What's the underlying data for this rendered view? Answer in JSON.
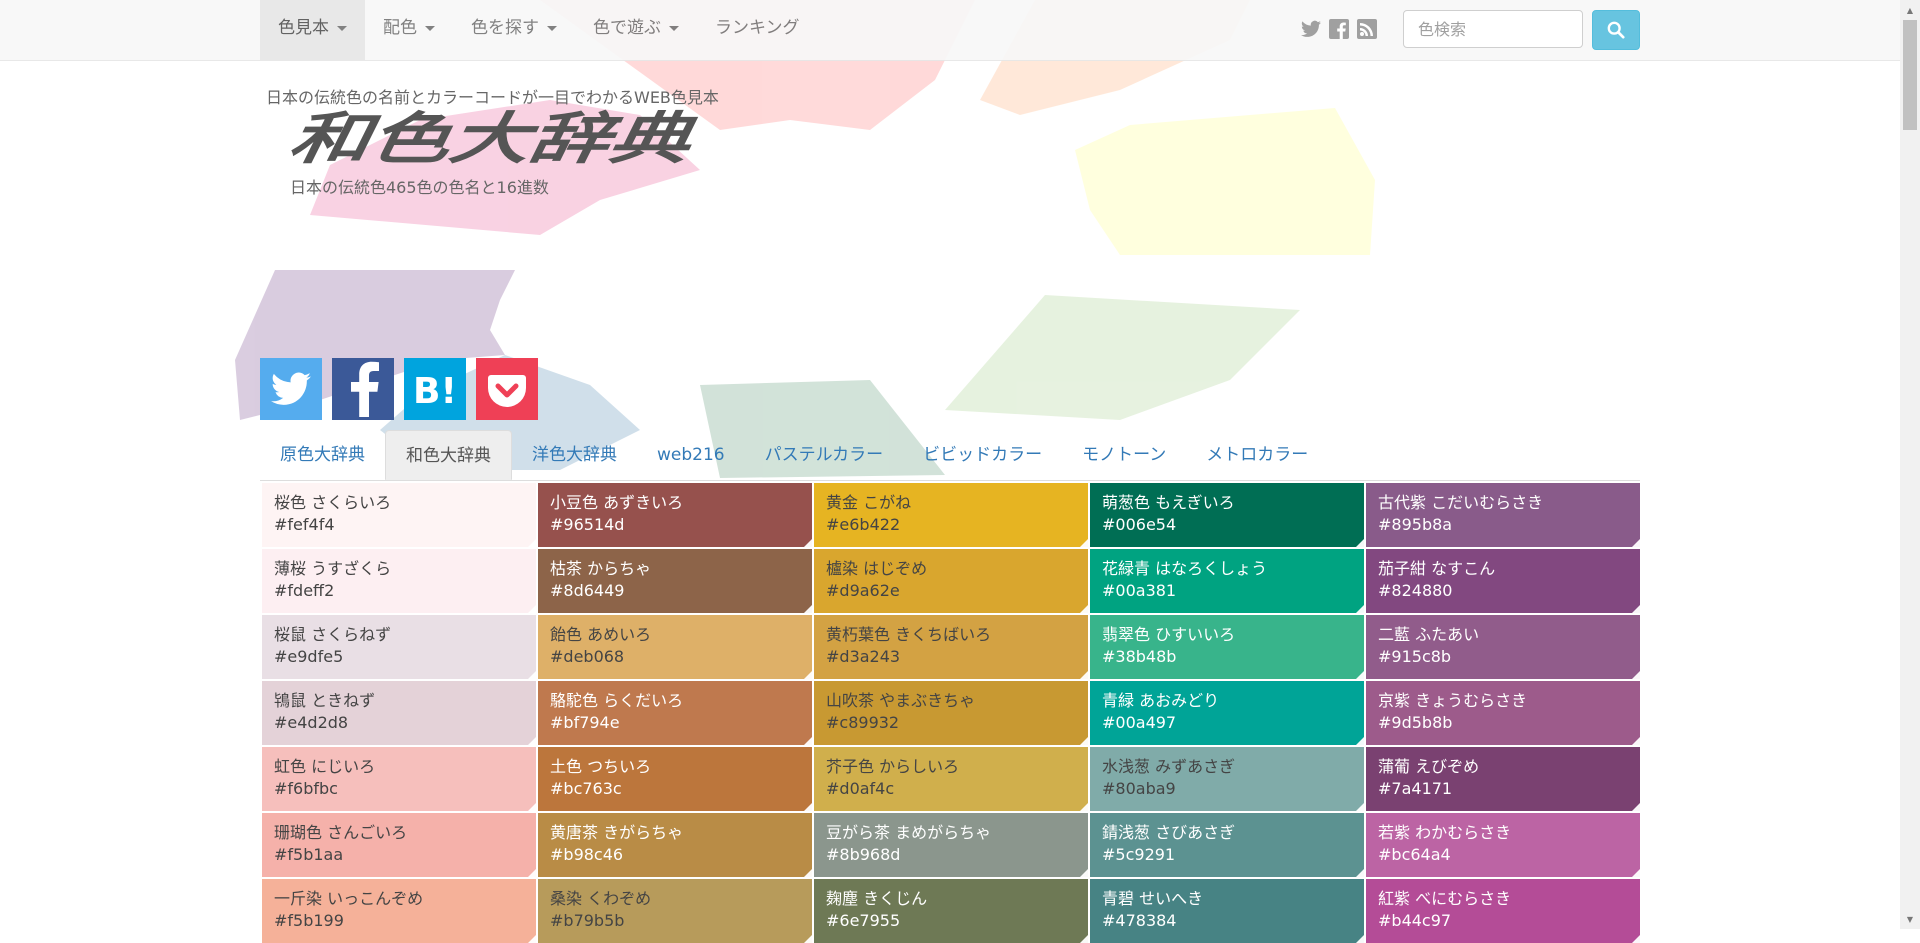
{
  "navbar": {
    "items": [
      {
        "label": "色見本",
        "dropdown": true,
        "active": true
      },
      {
        "label": "配色",
        "dropdown": true
      },
      {
        "label": "色を探す",
        "dropdown": true
      },
      {
        "label": "色で遊ぶ",
        "dropdown": true
      },
      {
        "label": "ランキング",
        "dropdown": false
      }
    ],
    "social_icons": [
      "twitter-icon",
      "facebook-icon",
      "rss-icon"
    ],
    "search": {
      "placeholder": "色検索",
      "value": ""
    }
  },
  "header": {
    "tagline": "日本の伝統色の名前とカラーコードが一目でわかるWEB色見本",
    "logo_text": "和色大辞典",
    "subtitle": "日本の伝統色465色の色名と16進数"
  },
  "share_buttons": [
    {
      "name": "twitter",
      "color": "#55acee"
    },
    {
      "name": "facebook",
      "color": "#3b5998"
    },
    {
      "name": "hatena-bookmark",
      "color": "#00a4de"
    },
    {
      "name": "pocket",
      "color": "#ef4056"
    }
  ],
  "tabs": [
    {
      "label": "原色大辞典",
      "active": false
    },
    {
      "label": "和色大辞典",
      "active": true
    },
    {
      "label": "洋色大辞典",
      "active": false
    },
    {
      "label": "web216",
      "active": false
    },
    {
      "label": "パステルカラー",
      "active": false
    },
    {
      "label": "ビビッドカラー",
      "active": false
    },
    {
      "label": "モノトーン",
      "active": false
    },
    {
      "label": "メトロカラー",
      "active": false
    }
  ],
  "colors": [
    [
      {
        "name": "桜色 さくらいろ",
        "hex": "#fef4f4"
      },
      {
        "name": "小豆色 あずきいろ",
        "hex": "#96514d"
      },
      {
        "name": "黄金 こがね",
        "hex": "#e6b422"
      },
      {
        "name": "萌葱色 もえぎいろ",
        "hex": "#006e54"
      },
      {
        "name": "古代紫 こだいむらさき",
        "hex": "#895b8a"
      }
    ],
    [
      {
        "name": "薄桜 うすざくら",
        "hex": "#fdeff2"
      },
      {
        "name": "枯茶 からちゃ",
        "hex": "#8d6449"
      },
      {
        "name": "櫨染 はじぞめ",
        "hex": "#d9a62e"
      },
      {
        "name": "花緑青 はなろくしょう",
        "hex": "#00a381"
      },
      {
        "name": "茄子紺 なすこん",
        "hex": "#824880"
      }
    ],
    [
      {
        "name": "桜鼠 さくらねず",
        "hex": "#e9dfe5"
      },
      {
        "name": "飴色 あめいろ",
        "hex": "#deb068"
      },
      {
        "name": "黄朽葉色 きくちばいろ",
        "hex": "#d3a243"
      },
      {
        "name": "翡翠色 ひすいいろ",
        "hex": "#38b48b"
      },
      {
        "name": "二藍 ふたあい",
        "hex": "#915c8b"
      }
    ],
    [
      {
        "name": "鴇鼠 ときねず",
        "hex": "#e4d2d8"
      },
      {
        "name": "駱駝色 らくだいろ",
        "hex": "#bf794e"
      },
      {
        "name": "山吹茶 やまぶきちゃ",
        "hex": "#c89932"
      },
      {
        "name": "青緑 あおみどり",
        "hex": "#00a497"
      },
      {
        "name": "京紫 きょうむらさき",
        "hex": "#9d5b8b"
      }
    ],
    [
      {
        "name": "虹色 にじいろ",
        "hex": "#f6bfbc"
      },
      {
        "name": "土色 つちいろ",
        "hex": "#bc763c"
      },
      {
        "name": "芥子色 からしいろ",
        "hex": "#d0af4c"
      },
      {
        "name": "水浅葱 みずあさぎ",
        "hex": "#80aba9"
      },
      {
        "name": "蒲葡 えびぞめ",
        "hex": "#7a4171"
      }
    ],
    [
      {
        "name": "珊瑚色 さんごいろ",
        "hex": "#f5b1aa"
      },
      {
        "name": "黄唐茶 きがらちゃ",
        "hex": "#b98c46"
      },
      {
        "name": "豆がら茶 まめがらちゃ",
        "hex": "#8b968d"
      },
      {
        "name": "錆浅葱 さびあさぎ",
        "hex": "#5c9291"
      },
      {
        "name": "若紫 わかむらさき",
        "hex": "#bc64a4"
      }
    ],
    [
      {
        "name": "一斤染 いっこんぞめ",
        "hex": "#f5b199"
      },
      {
        "name": "桑染 くわぞめ",
        "hex": "#b79b5b"
      },
      {
        "name": "麹塵 きくじん",
        "hex": "#6e7955"
      },
      {
        "name": "青碧 せいへき",
        "hex": "#478384"
      },
      {
        "name": "紅紫 べにむらさき",
        "hex": "#b44c97"
      }
    ]
  ]
}
